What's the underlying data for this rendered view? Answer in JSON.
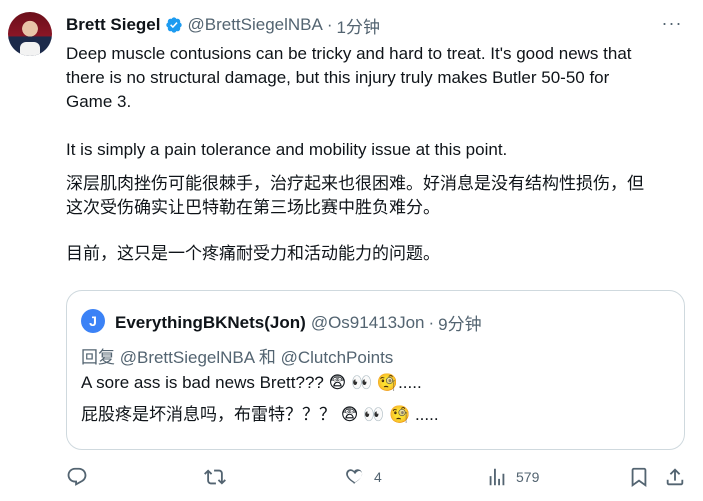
{
  "author": {
    "name": "Brett Siegel",
    "handle": "@BrettSiegelNBA",
    "separator": "·",
    "time": "1分钟"
  },
  "tweet": {
    "paragraph1": "Deep muscle contusions can be tricky and hard to treat. It's good news that\nthere is no structural damage, but this injury truly makes Butler 50-50 for\nGame 3.",
    "paragraph2": "It is simply a pain tolerance and mobility issue at this point.",
    "translation1": "深层肌肉挫伤可能很棘手，治疗起来也很困难。好消息是没有结构性损伤，但\n这次受伤确实让巴特勒在第三场比赛中胜负难分。",
    "translation2": "目前，这只是一个疼痛耐受力和活动能力的问题。"
  },
  "quote": {
    "avatar_letter": "J",
    "name": "EverythingBKNets(Jon)",
    "handle": "@Os91413Jon",
    "separator": "·",
    "time": "9分钟",
    "reply_to": "回复 @BrettSiegelNBA 和 @ClutchPoints",
    "text": "A sore ass is bad news Brett??? 😨 👀 🧐.....",
    "translation": "屁股疼是坏消息吗，布雷特？？？ 😨 👀 🧐 ....."
  },
  "actions": {
    "reply_count": "",
    "retweet_count": "",
    "like_count": "4",
    "views_count": "579"
  },
  "icons": [
    "more-icon",
    "verified-icon",
    "reply-icon",
    "retweet-icon",
    "like-icon",
    "views-icon",
    "bookmark-icon",
    "share-icon"
  ],
  "colors": {
    "verified": "#1d9bf0",
    "secondary_text": "#536471",
    "border": "#cfd9de"
  }
}
